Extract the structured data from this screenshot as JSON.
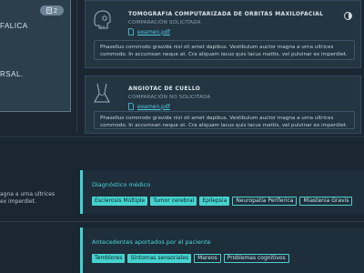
{
  "left_card": {
    "count": "2",
    "text_1": "FALICA",
    "text_2": "RSAL."
  },
  "studies": [
    {
      "title": "TOMOGRAFIA COMPUTARIZADA DE ORBITAS MAXILOFACIAL",
      "comparison": "COMPARACIÓN SOLICITADA",
      "file": "examen.pdf",
      "notes": "Phasellus commodo gravida nisi sit amet dapibus. Vestibulum auctor magna a urna ultrices commodo. In accumsan neque at. Cra aliquam lacus quis lacus mattis, vel pulvinar ex imperdiet.",
      "icon": "skull-icon"
    },
    {
      "title": "ANGIOTAC DE CUELLO",
      "comparison": "COMPARACIÓN NO SOLICITADA",
      "file": "examen.pdf",
      "notes": "Phasellus commodo gravida nisi sit amet dapibus. Vestibulum auctor magna a urna ultrices commodo. In accumsan neque at. Cra aliquam lacus quis lacus mattis, vel pulvinar ex imperdiet.",
      "icon": "neck-icon"
    }
  ],
  "lower_left": {
    "line_1": "agna a urna ultrices",
    "line_2": "ex imperdiet."
  },
  "diagnostico": {
    "title": "Diagnóstico médico",
    "tags": [
      {
        "label": "Esclerosis Múltiple",
        "selected": true
      },
      {
        "label": "Tumor cerebral",
        "selected": true
      },
      {
        "label": "Epilepsia",
        "selected": true
      },
      {
        "label": "Neuropatía Periferica",
        "selected": false
      },
      {
        "label": "Miastenia Gravis",
        "selected": false
      }
    ]
  },
  "antecedentes": {
    "title": "Antecedentes aportados por el paciente",
    "tags": [
      {
        "label": "Temblores",
        "selected": true
      },
      {
        "label": "Síntomas sensoriales",
        "selected": true
      },
      {
        "label": "Mareos",
        "selected": false
      },
      {
        "label": "Problemas cognitivos",
        "selected": false
      }
    ]
  },
  "colors": {
    "accent": "#45d3cf",
    "background": "#1a2632",
    "card": "#2c3f4d"
  }
}
